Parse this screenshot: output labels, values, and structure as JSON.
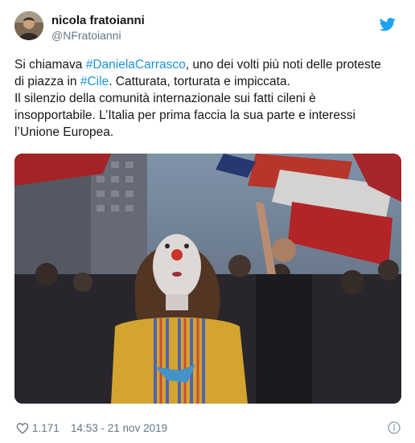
{
  "user": {
    "display_name": "nicola fratoianni",
    "handle": "@NFratoianni"
  },
  "tweet": {
    "line1_pre": "Si chiamava ",
    "hashtag1": "#DanielaCarrasco",
    "line1_post": ", uno dei volti più noti delle proteste",
    "line2_pre": "di piazza in ",
    "hashtag2": "#Cile",
    "line2_post": ". Catturata, torturata e impiccata.",
    "line3": "Il silenzio della comunità internazionale sui fatti cileni è",
    "line4": "insopportabile. L’Italia per prima faccia la sua parte e interessi",
    "line5": "l’Unione Europea."
  },
  "footer": {
    "likes": "1.171",
    "timestamp": "14:53 - 21 nov 2019"
  },
  "icons": {
    "logo": "twitter-bird-icon",
    "like": "heart-icon",
    "info": "info-icon"
  },
  "colors": {
    "link": "#1b95e0",
    "brand": "#1da1f2",
    "muted": "#657786"
  }
}
